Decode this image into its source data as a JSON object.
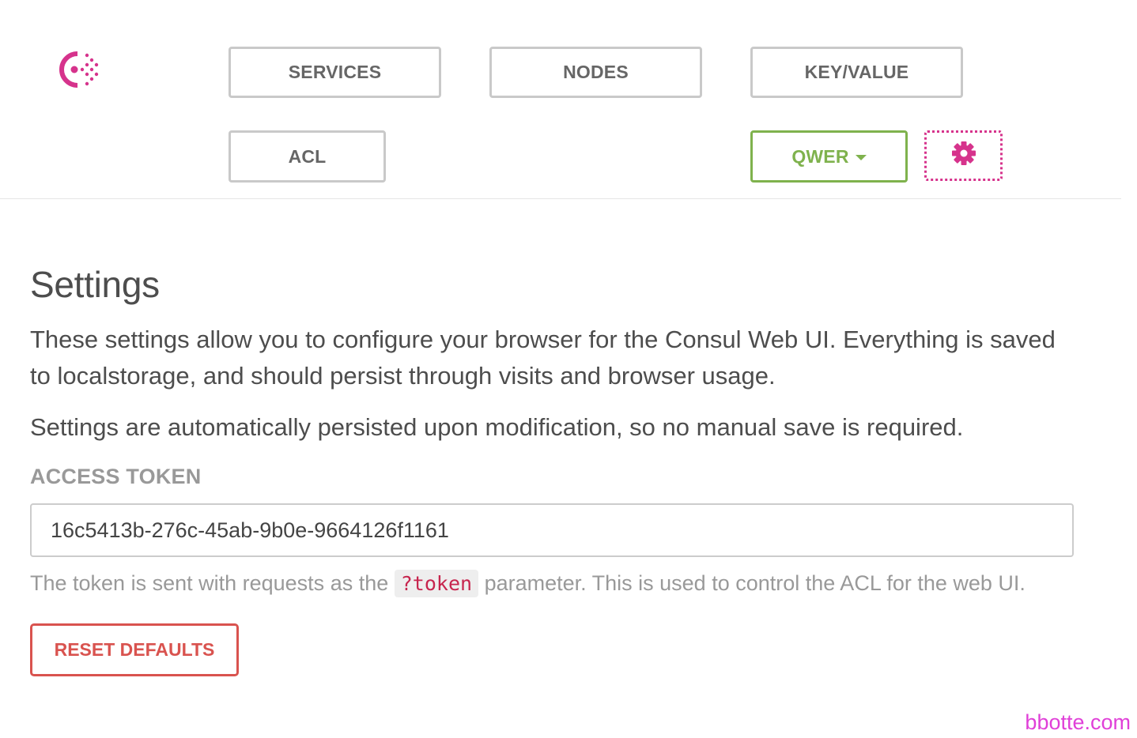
{
  "header": {
    "logo_icon": "consul-logo-icon",
    "nav": {
      "services_label": "SERVICES",
      "nodes_label": "NODES",
      "kv_label": "KEY/VALUE",
      "acl_label": "ACL",
      "datacenter_label": "QWER",
      "settings_icon": "gear-icon"
    }
  },
  "settings": {
    "title": "Settings",
    "description": "These settings allow you to configure your browser for the Consul Web UI. Everything is saved to localstorage, and should persist through visits and browser usage.",
    "persist_note": "Settings are automatically persisted upon modification, so no manual save is required.",
    "token_label": "ACCESS TOKEN",
    "token_value": "16c5413b-276c-45ab-9b0e-9664126f1161",
    "help_before": "The token is sent with requests as the ",
    "help_code": "?token",
    "help_after": " parameter. This is used to control the ACL for the web UI.",
    "reset_label": "RESET DEFAULTS"
  },
  "watermark": "bbotte.com",
  "colors": {
    "brand": "#d6338c",
    "datacenter": "#7fb24d",
    "danger": "#d9534f",
    "nav_border": "#c9c9c9"
  }
}
